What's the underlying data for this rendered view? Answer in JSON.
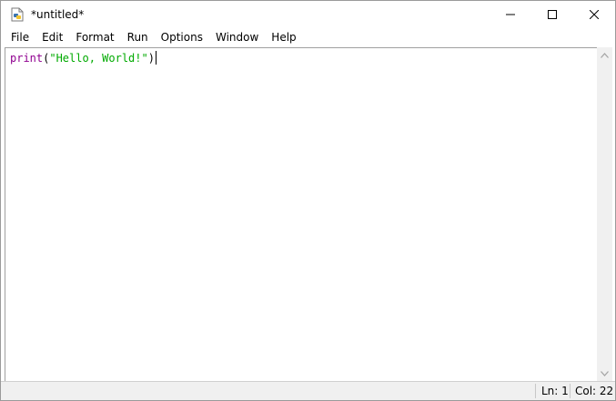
{
  "window": {
    "title": "*untitled*",
    "icon": "python-idle-icon"
  },
  "menubar": {
    "items": [
      {
        "label": "File"
      },
      {
        "label": "Edit"
      },
      {
        "label": "Format"
      },
      {
        "label": "Run"
      },
      {
        "label": "Options"
      },
      {
        "label": "Window"
      },
      {
        "label": "Help"
      }
    ]
  },
  "editor": {
    "tokens": {
      "builtin": "print",
      "open_paren": "(",
      "string": "\"Hello, World!\"",
      "close_paren": ")"
    },
    "colors": {
      "builtin": "#900090",
      "string": "#00aa00"
    }
  },
  "statusbar": {
    "line": "Ln: 1",
    "column": "Col: 22"
  }
}
